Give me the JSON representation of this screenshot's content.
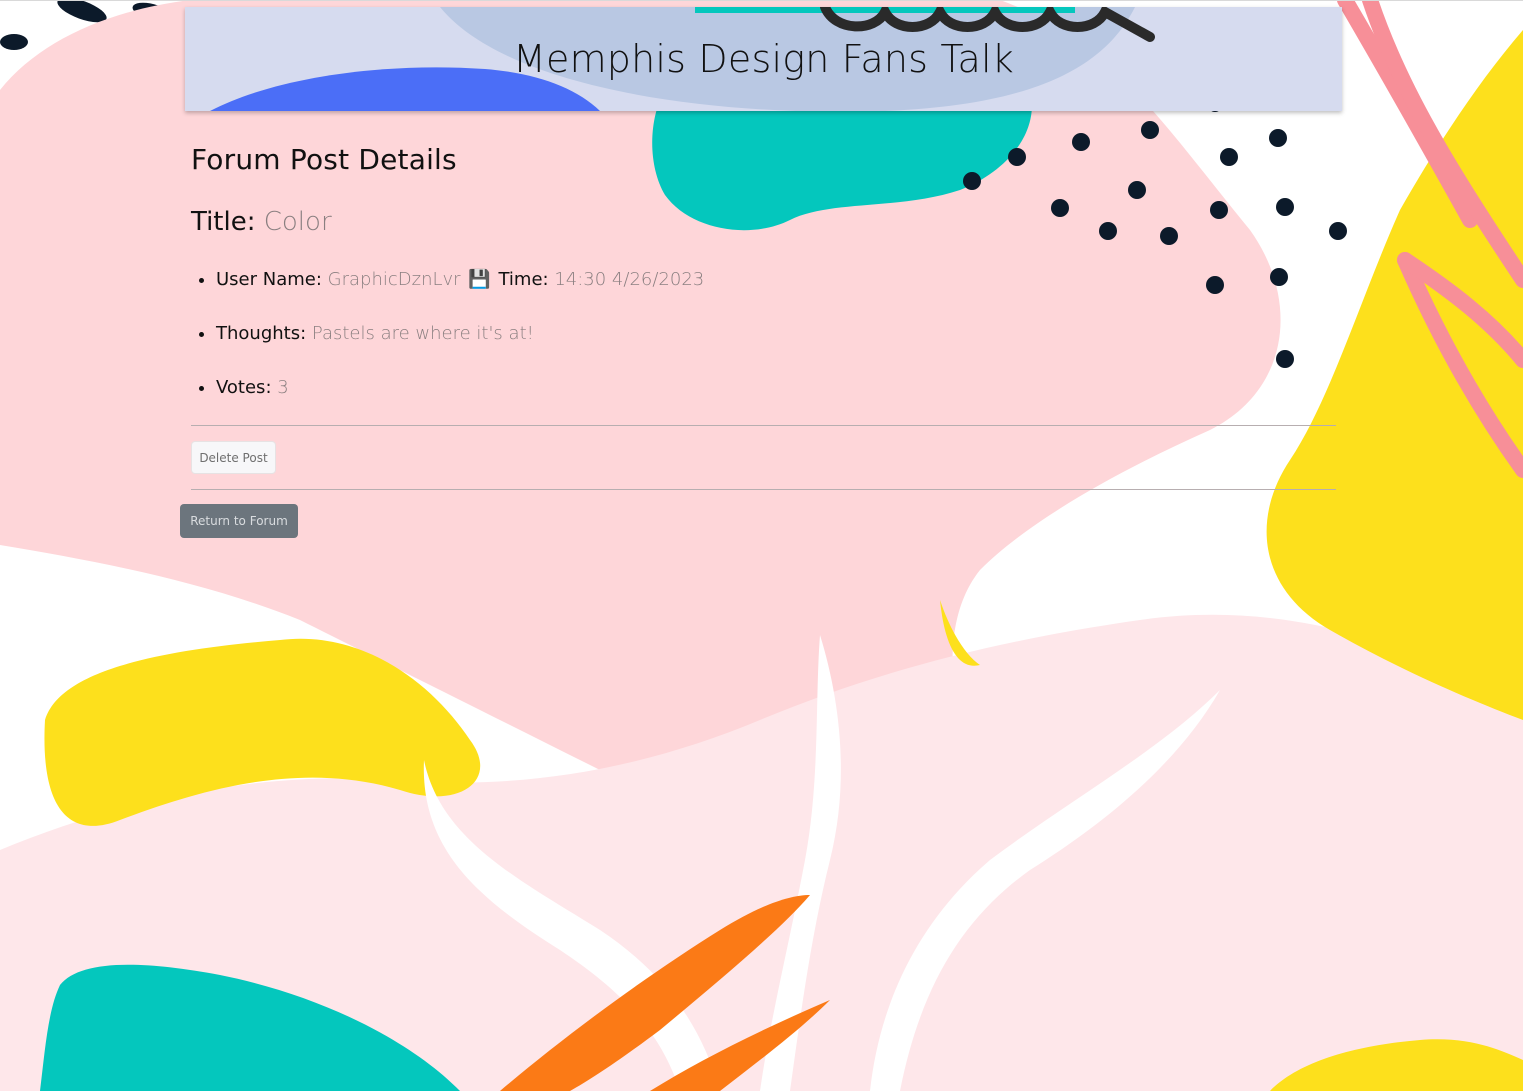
{
  "header": {
    "site_title": "Memphis Design Fans Talk"
  },
  "main": {
    "page_heading": "Forum Post Details",
    "title_label": "Title:",
    "title_value": "Color",
    "details": {
      "user_label": "User Name:",
      "user_value": "GraphicDznLvr",
      "time_icon": "floppy-disk-icon",
      "time_icon_glyph": "💾",
      "time_label": "Time:",
      "time_value": "14:30 4/26/2023",
      "thoughts_label": "Thoughts:",
      "thoughts_value": "Pastels are where it's at!",
      "votes_label": "Votes:",
      "votes_value": "3"
    }
  },
  "actions": {
    "delete_label": "Delete Post",
    "return_label": "Return to Forum"
  },
  "colors": {
    "pink": "#fed6d9",
    "light_pink": "#fee7ea",
    "yellow": "#fde01c",
    "teal": "#04c7bd",
    "navy": "#0c1a2a",
    "coral": "#f78f98",
    "orange": "#fb7a16",
    "header_bg": "#d6dbef",
    "header_blue": "#4b6ef7",
    "button_gray": "#6c757d"
  }
}
